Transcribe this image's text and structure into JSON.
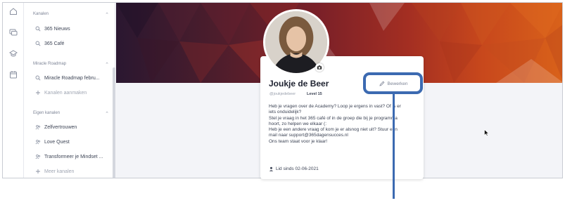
{
  "rail": {
    "icons": [
      "home-icon",
      "chat-icon",
      "learning-icon",
      "calendar-icon"
    ]
  },
  "sidebar": {
    "sections": [
      {
        "title": "Kanalen",
        "items": [
          {
            "label": "365 Nieuws",
            "icon": "channel-icon"
          },
          {
            "label": "365 Café",
            "icon": "channel-icon"
          }
        ]
      },
      {
        "title": "Miracle Roadmap",
        "items": [
          {
            "label": "Miracle Roadmap febru...",
            "icon": "channel-icon"
          },
          {
            "label": "Kanalen aanmaken",
            "icon": "plus-icon"
          }
        ]
      },
      {
        "title": "Eigen kanalen",
        "items": [
          {
            "label": "Zelfvertrouwen",
            "icon": "group-icon"
          },
          {
            "label": "Love Quest",
            "icon": "group-icon"
          },
          {
            "label": "Transformeer je Mindset ...",
            "icon": "group-icon"
          },
          {
            "label": "Meer kanalen",
            "icon": "plus-icon"
          }
        ]
      }
    ]
  },
  "profile": {
    "name": "Joukje de Beer",
    "handle": "@joukjedebeer",
    "level": "Level 15",
    "edit_label": "Bewerken",
    "bio": [
      "Heb je vragen over de Academy? Loop je ergens in vast? Of is er",
      "iets onduidelijk?",
      "Stel je vraag in het 365 café of in de groep die bij je programma",
      "hoort, zo helpen we elkaar (:",
      "Heb je een andere vraag of kom je er alsnog niet uit? Stuur een",
      "mail naar support@365dagensucces.nl",
      "Ons team staat voor je klaar!"
    ],
    "member_since": "Lid sinds 02-06-2021"
  },
  "colors": {
    "accent": "#3c6ab1",
    "banner_start": "#2a1730",
    "banner_end": "#d9621a"
  }
}
